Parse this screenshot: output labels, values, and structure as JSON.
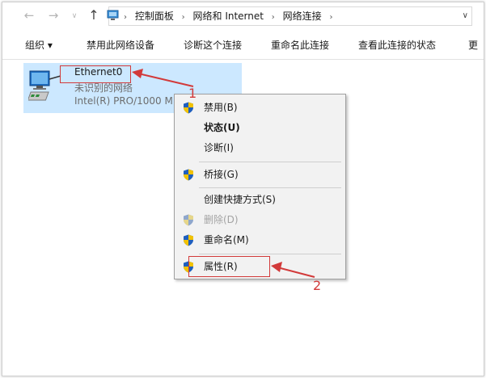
{
  "address": {
    "crumbs": [
      "控制面板",
      "网络和 Internet",
      "网络连接"
    ]
  },
  "toolbar": {
    "organize": "组织 ▾",
    "disable": "禁用此网络设备",
    "diagnose": "诊断这个连接",
    "rename": "重命名此连接",
    "view_status": "查看此连接的状态",
    "more": "更"
  },
  "connection": {
    "name": "Ethernet0",
    "status": "未识别的网络",
    "device": "Intel(R) PRO/1000 M"
  },
  "context_menu": {
    "items": [
      {
        "label": "禁用(B)"
      },
      {
        "label": "状态(U)"
      },
      {
        "label": "诊断(I)"
      },
      {
        "label": "桥接(G)"
      },
      {
        "label": "创建快捷方式(S)"
      },
      {
        "label": "删除(D)"
      },
      {
        "label": "重命名(M)"
      },
      {
        "label": "属性(R)"
      }
    ]
  },
  "annotations": {
    "step1": "1",
    "step2": "2"
  },
  "colors": {
    "selection": "#cce8ff",
    "annotation": "#d23a3a",
    "menu_bg": "#f2f2f2"
  }
}
